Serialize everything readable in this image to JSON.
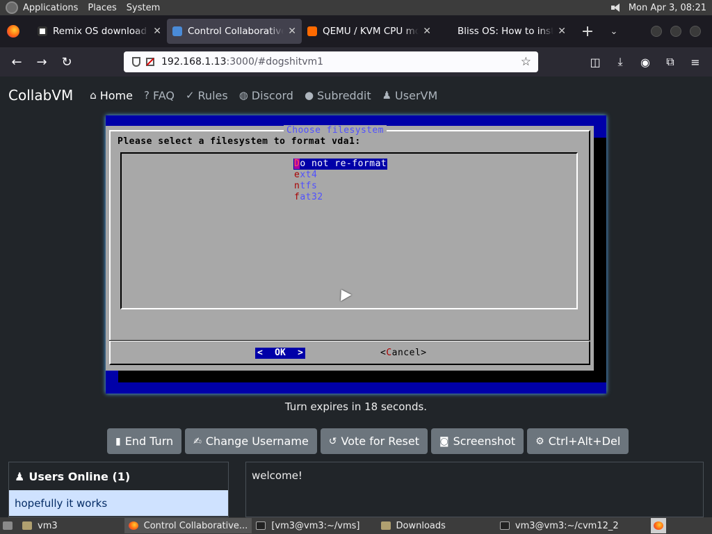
{
  "panel": {
    "menus": [
      "Applications",
      "Places",
      "System"
    ],
    "clock": "Mon Apr  3, 08:21"
  },
  "tabs": [
    {
      "title": "Remix OS download la",
      "favicon": "remix-icon"
    },
    {
      "title": "Control Collaborative V",
      "favicon": "collabvm-icon",
      "active": true
    },
    {
      "title": "QEMU / KVM CPU mo",
      "favicon": "qemu-icon"
    },
    {
      "title": "Bliss OS: How to install Bli",
      "favicon": "bliss-icon"
    }
  ],
  "url": {
    "host": "192.168.1.13",
    "rest": ":3000/#dogshitvm1"
  },
  "site": {
    "brand": "CollabVM",
    "nav": [
      {
        "label": "Home",
        "icon": "home-icon"
      },
      {
        "label": "FAQ",
        "icon": "question-icon"
      },
      {
        "label": "Rules",
        "icon": "clipboard-icon"
      },
      {
        "label": "Discord",
        "icon": "discord-icon"
      },
      {
        "label": "Subreddit",
        "icon": "reddit-icon"
      },
      {
        "label": "UserVM",
        "icon": "user-icon"
      }
    ]
  },
  "vm": {
    "dialog_title": "Choose filesystem",
    "prompt": "Please select a filesystem to format vda1:",
    "options": [
      {
        "hot": "D",
        "rest": "o not re-format",
        "selected": true
      },
      {
        "hot": "e",
        "rest": "xt4"
      },
      {
        "hot": "n",
        "rest": "tfs"
      },
      {
        "hot": "f",
        "rest": "at32"
      }
    ],
    "ok_left": "<",
    "ok_label": "OK",
    "ok_right": ">",
    "cancel_open": "<",
    "cancel_hot": "C",
    "cancel_rest": "ancel",
    "cancel_close": ">"
  },
  "turn_text": "Turn expires in 18 seconds.",
  "actions": [
    {
      "label": "End Turn",
      "icon": "mouse-icon"
    },
    {
      "label": "Change Username",
      "icon": "signature-icon"
    },
    {
      "label": "Vote for Reset",
      "icon": "rotate-left-icon"
    },
    {
      "label": "Screenshot",
      "icon": "camera-icon"
    },
    {
      "label": "Ctrl+Alt+Del",
      "icon": "gear-icon"
    }
  ],
  "users": {
    "title": "Users Online (1)",
    "list": [
      "hopefully it works"
    ]
  },
  "chat": {
    "messages": [
      "welcome!"
    ]
  },
  "taskbar": {
    "items": [
      {
        "label": "vm3",
        "icon": "folder-home-icon"
      },
      {
        "label": "Control Collaborative...",
        "icon": "firefox-icon",
        "active": true
      },
      {
        "label": "[vm3@vm3:~/vms]",
        "icon": "terminal-icon"
      },
      {
        "label": "Downloads",
        "icon": "folder-icon"
      },
      {
        "label": "vm3@vm3:~/cvm12_2",
        "icon": "terminal-icon"
      }
    ]
  }
}
